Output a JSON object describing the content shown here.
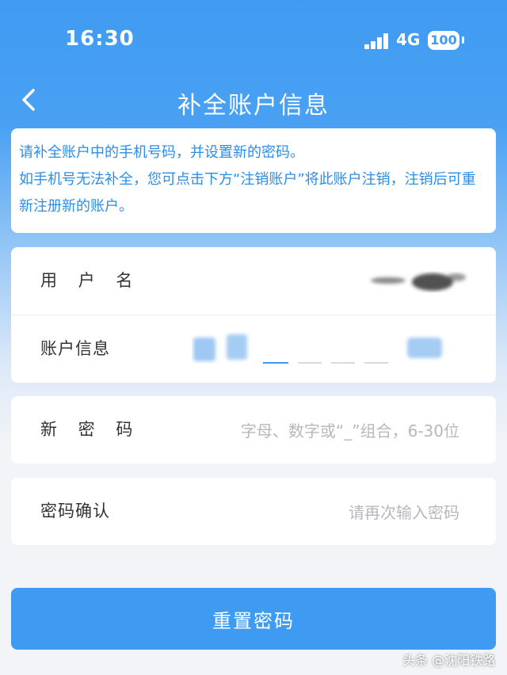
{
  "status_bar": {
    "time": "16:30",
    "network": "4G",
    "battery": "100"
  },
  "nav": {
    "title": "补全账户信息"
  },
  "notice": {
    "line1": "请补全账户中的手机号码，并设置新的密码。",
    "line2": "如手机号无法补全，您可点击下方“注销账户”将此账户注销，注销后可重新注册新的账户。"
  },
  "form": {
    "username_label": "用 户 名",
    "account_info_label": "账户信息",
    "new_password_label": "新 密 码",
    "new_password_placeholder": "字母、数字或“_”组合，6-30位",
    "confirm_password_label": "密码确认",
    "confirm_password_placeholder": "请再次输入密码"
  },
  "button": {
    "reset_label": "重置密码"
  },
  "watermark": "头条 @沈阳铁路",
  "colors": {
    "accent": "#3f9bf2",
    "notice_text": "#2b8de8"
  }
}
